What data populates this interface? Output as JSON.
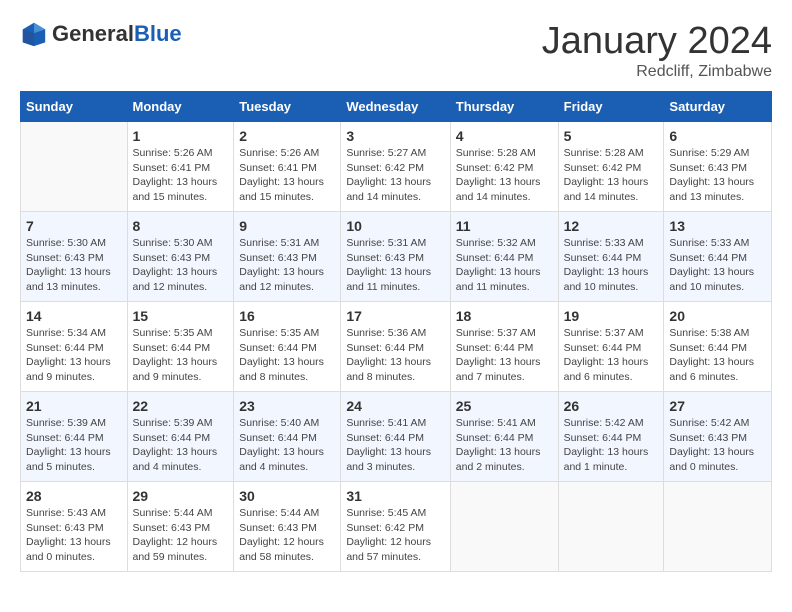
{
  "header": {
    "logo_general": "General",
    "logo_blue": "Blue",
    "month_title": "January 2024",
    "location": "Redcliff, Zimbabwe"
  },
  "days_of_week": [
    "Sunday",
    "Monday",
    "Tuesday",
    "Wednesday",
    "Thursday",
    "Friday",
    "Saturday"
  ],
  "weeks": [
    [
      {
        "day": "",
        "info": ""
      },
      {
        "day": "1",
        "info": "Sunrise: 5:26 AM\nSunset: 6:41 PM\nDaylight: 13 hours and 15 minutes."
      },
      {
        "day": "2",
        "info": "Sunrise: 5:26 AM\nSunset: 6:41 PM\nDaylight: 13 hours and 15 minutes."
      },
      {
        "day": "3",
        "info": "Sunrise: 5:27 AM\nSunset: 6:42 PM\nDaylight: 13 hours and 14 minutes."
      },
      {
        "day": "4",
        "info": "Sunrise: 5:28 AM\nSunset: 6:42 PM\nDaylight: 13 hours and 14 minutes."
      },
      {
        "day": "5",
        "info": "Sunrise: 5:28 AM\nSunset: 6:42 PM\nDaylight: 13 hours and 14 minutes."
      },
      {
        "day": "6",
        "info": "Sunrise: 5:29 AM\nSunset: 6:43 PM\nDaylight: 13 hours and 13 minutes."
      }
    ],
    [
      {
        "day": "7",
        "info": "Sunrise: 5:30 AM\nSunset: 6:43 PM\nDaylight: 13 hours and 13 minutes."
      },
      {
        "day": "8",
        "info": "Sunrise: 5:30 AM\nSunset: 6:43 PM\nDaylight: 13 hours and 12 minutes."
      },
      {
        "day": "9",
        "info": "Sunrise: 5:31 AM\nSunset: 6:43 PM\nDaylight: 13 hours and 12 minutes."
      },
      {
        "day": "10",
        "info": "Sunrise: 5:31 AM\nSunset: 6:43 PM\nDaylight: 13 hours and 11 minutes."
      },
      {
        "day": "11",
        "info": "Sunrise: 5:32 AM\nSunset: 6:44 PM\nDaylight: 13 hours and 11 minutes."
      },
      {
        "day": "12",
        "info": "Sunrise: 5:33 AM\nSunset: 6:44 PM\nDaylight: 13 hours and 10 minutes."
      },
      {
        "day": "13",
        "info": "Sunrise: 5:33 AM\nSunset: 6:44 PM\nDaylight: 13 hours and 10 minutes."
      }
    ],
    [
      {
        "day": "14",
        "info": "Sunrise: 5:34 AM\nSunset: 6:44 PM\nDaylight: 13 hours and 9 minutes."
      },
      {
        "day": "15",
        "info": "Sunrise: 5:35 AM\nSunset: 6:44 PM\nDaylight: 13 hours and 9 minutes."
      },
      {
        "day": "16",
        "info": "Sunrise: 5:35 AM\nSunset: 6:44 PM\nDaylight: 13 hours and 8 minutes."
      },
      {
        "day": "17",
        "info": "Sunrise: 5:36 AM\nSunset: 6:44 PM\nDaylight: 13 hours and 8 minutes."
      },
      {
        "day": "18",
        "info": "Sunrise: 5:37 AM\nSunset: 6:44 PM\nDaylight: 13 hours and 7 minutes."
      },
      {
        "day": "19",
        "info": "Sunrise: 5:37 AM\nSunset: 6:44 PM\nDaylight: 13 hours and 6 minutes."
      },
      {
        "day": "20",
        "info": "Sunrise: 5:38 AM\nSunset: 6:44 PM\nDaylight: 13 hours and 6 minutes."
      }
    ],
    [
      {
        "day": "21",
        "info": "Sunrise: 5:39 AM\nSunset: 6:44 PM\nDaylight: 13 hours and 5 minutes."
      },
      {
        "day": "22",
        "info": "Sunrise: 5:39 AM\nSunset: 6:44 PM\nDaylight: 13 hours and 4 minutes."
      },
      {
        "day": "23",
        "info": "Sunrise: 5:40 AM\nSunset: 6:44 PM\nDaylight: 13 hours and 4 minutes."
      },
      {
        "day": "24",
        "info": "Sunrise: 5:41 AM\nSunset: 6:44 PM\nDaylight: 13 hours and 3 minutes."
      },
      {
        "day": "25",
        "info": "Sunrise: 5:41 AM\nSunset: 6:44 PM\nDaylight: 13 hours and 2 minutes."
      },
      {
        "day": "26",
        "info": "Sunrise: 5:42 AM\nSunset: 6:44 PM\nDaylight: 13 hours and 1 minute."
      },
      {
        "day": "27",
        "info": "Sunrise: 5:42 AM\nSunset: 6:43 PM\nDaylight: 13 hours and 0 minutes."
      }
    ],
    [
      {
        "day": "28",
        "info": "Sunrise: 5:43 AM\nSunset: 6:43 PM\nDaylight: 13 hours and 0 minutes."
      },
      {
        "day": "29",
        "info": "Sunrise: 5:44 AM\nSunset: 6:43 PM\nDaylight: 12 hours and 59 minutes."
      },
      {
        "day": "30",
        "info": "Sunrise: 5:44 AM\nSunset: 6:43 PM\nDaylight: 12 hours and 58 minutes."
      },
      {
        "day": "31",
        "info": "Sunrise: 5:45 AM\nSunset: 6:42 PM\nDaylight: 12 hours and 57 minutes."
      },
      {
        "day": "",
        "info": ""
      },
      {
        "day": "",
        "info": ""
      },
      {
        "day": "",
        "info": ""
      }
    ]
  ]
}
